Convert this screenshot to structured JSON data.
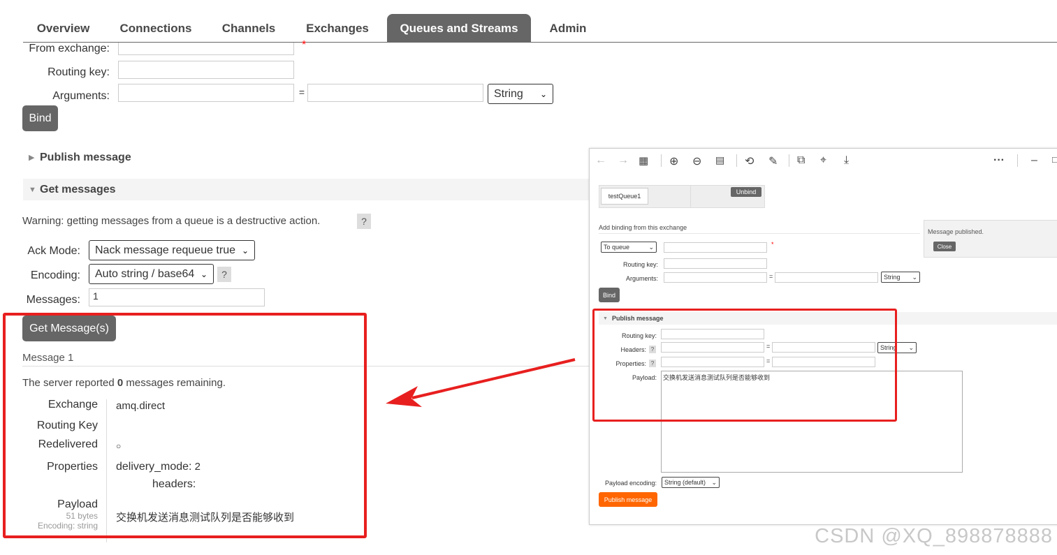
{
  "nav": {
    "tabs": [
      "Overview",
      "Connections",
      "Channels",
      "Exchanges",
      "Queues and Streams",
      "Admin"
    ],
    "active": "Queues and Streams"
  },
  "binding": {
    "from_exchange_label": "From exchange:",
    "routing_key_label": "Routing key:",
    "arguments_label": "Arguments:",
    "equals": "=",
    "type_select": "String",
    "required_mark": "*",
    "bind_button": "Bind"
  },
  "publish_section": {
    "title": "Publish message",
    "expanded": false
  },
  "get_section": {
    "title": "Get messages",
    "expanded": true,
    "warning": "Warning: getting messages from a queue is a destructive action.",
    "help": "?",
    "ack_mode_label": "Ack Mode:",
    "ack_mode_value": "Nack message requeue true",
    "encoding_label": "Encoding:",
    "encoding_value": "Auto string / base64",
    "messages_label": "Messages:",
    "messages_value": "1",
    "get_button": "Get Message(s)"
  },
  "message": {
    "heading": "Message 1",
    "server_report_prefix": "The server reported ",
    "remaining_count": "0",
    "server_report_suffix": " messages remaining.",
    "exchange_label": "Exchange",
    "exchange_value": "amq.direct",
    "routing_key_label": "Routing Key",
    "routing_key_value": "",
    "redelivered_label": "Redelivered",
    "redelivered_value": "○",
    "properties_label": "Properties",
    "delivery_mode_key": "delivery_mode:",
    "delivery_mode_value": "2",
    "headers_key": "headers:",
    "payload_label": "Payload",
    "payload_size": "51 bytes",
    "payload_encoding": "Encoding: string",
    "payload_value": "交换机发送消息测试队列是否能够收到"
  },
  "inset": {
    "toolbar_icons": [
      "back-icon",
      "forward-icon",
      "grid-icon",
      "zoom-in-icon",
      "zoom-out-icon",
      "actual-size-icon",
      "rotate-icon",
      "edit-icon",
      "copy-icon",
      "crop-icon",
      "download-icon",
      "more-icon",
      "minimize-icon",
      "maximize-icon"
    ],
    "more": "···",
    "queue_name": "testQueue1",
    "unbind_button": "Unbind",
    "add_binding_title": "Add binding from this exchange",
    "notification_text": "Message published.",
    "notification_close": "Close",
    "to_queue_select": "To queue",
    "required_mark": "*",
    "routing_key_label": "Routing key:",
    "arguments_label": "Arguments:",
    "equals": "=",
    "string_select": "String",
    "bind_button": "Bind",
    "publish_title": "Publish message",
    "pub_routing_key_label": "Routing key:",
    "headers_label": "Headers:",
    "properties_label": "Properties:",
    "help": "?",
    "payload_label": "Payload:",
    "payload_value": "交换机发送消息测试队列是否能够收到",
    "payload_encoding_label": "Payload encoding:",
    "payload_encoding_value": "String (default)",
    "publish_button": "Publish message",
    "brand_color": "#f60"
  },
  "annotation": {
    "highlight_color": "#e81f1f"
  },
  "watermark": "CSDN @XQ_898878888"
}
